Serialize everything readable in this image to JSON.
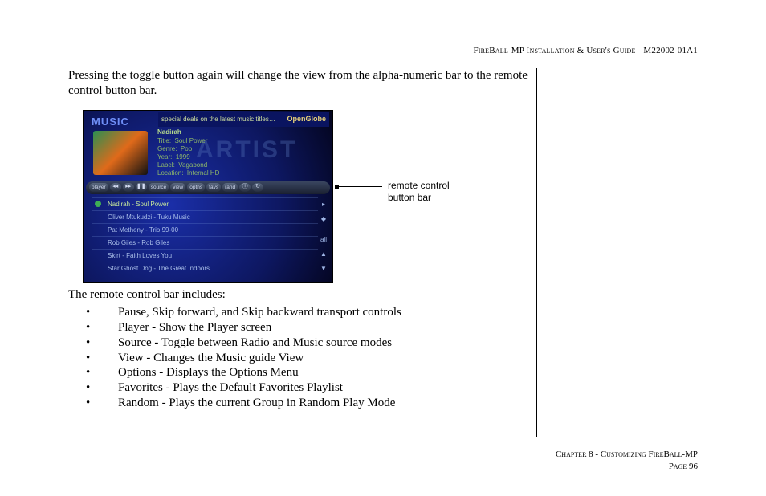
{
  "header": {
    "left": "FireBall-MP Installation & User's Guide",
    "right": "M22002-01A1"
  },
  "intro_para": "Pressing the toggle button again will change the view from the alpha-numeric bar to the remote control button bar.",
  "callout_line1": "remote control",
  "callout_line2": "button bar",
  "list_intro": "The remote control bar includes:",
  "features": [
    "Pause, Skip forward, and Skip backward transport controls",
    "Player - Show the Player screen",
    "Source - Toggle between Radio and Music source modes",
    "View - Changes the Music guide View",
    "Options - Displays the Options Menu",
    "Favorites - Plays the Default Favorites Playlist",
    "Random - Plays the current Group in Random Play Mode"
  ],
  "footer": {
    "chapter": "Chapter 8 - Customizing FireBall-MP",
    "page": "Page 96"
  },
  "screenshot": {
    "heading": "MUSIC",
    "banner_text": "special deals on the latest music titles…",
    "banner_brand": "OpenGlobe",
    "bg_word": "ARTIST",
    "nowplaying": {
      "artist": "Nadirah",
      "rows": [
        [
          "Title:",
          "Soul Power"
        ],
        [
          "Genre:",
          "Pop"
        ],
        [
          "Year:",
          "1999"
        ],
        [
          "Label:",
          "Vagabond"
        ],
        [
          "Location:",
          "Internal HD"
        ]
      ]
    },
    "toolbar": {
      "player": "player",
      "prev": "◂◂",
      "next": "▸▸",
      "pause": "❚❚",
      "source": "source",
      "view": "view",
      "options": "optns",
      "favs": "favs",
      "rand": "rand",
      "info": "ⓘ",
      "refresh": "↻"
    },
    "playlist": [
      "Nadirah - Soul Power",
      "Oliver Mtukudzi - Tuku Music",
      "Pat Metheny - Trio 99-00",
      "Rob Giles - Rob Giles",
      "Skirt - Faith Loves You",
      "Star Ghost Dog - The Great Indoors"
    ],
    "side_glyphs": [
      "▸",
      "◆",
      "",
      "all",
      "▲",
      "▼"
    ]
  }
}
